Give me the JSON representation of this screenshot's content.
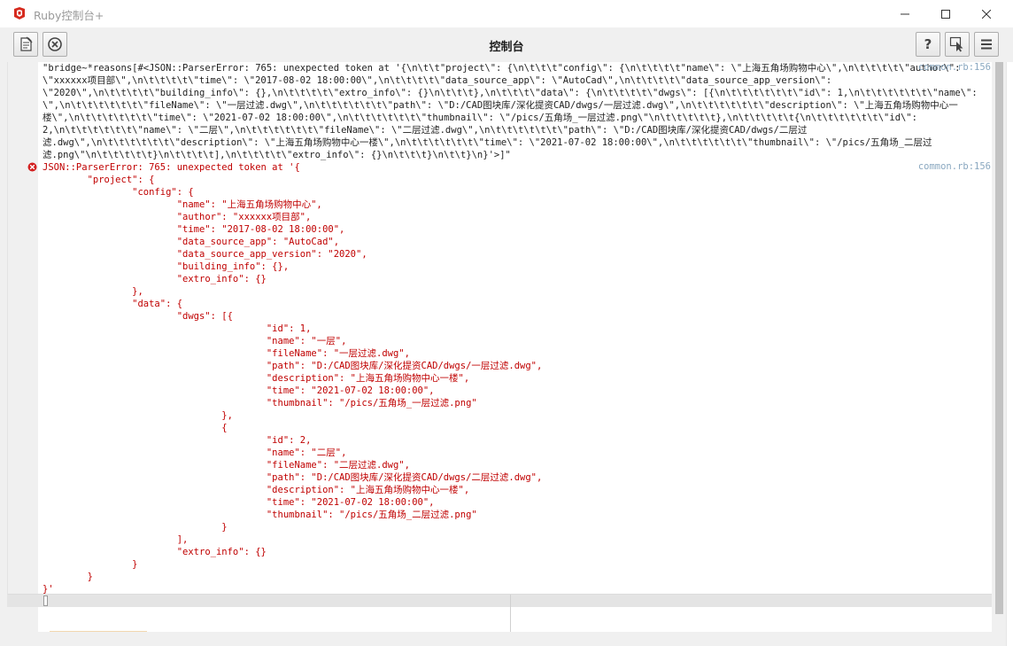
{
  "window": {
    "app_title": "Ruby控制台+",
    "app_icon": "sketchup-icon",
    "minimize_icon": "minimize-icon",
    "maximize_icon": "maximize-icon",
    "close_icon": "close-icon"
  },
  "toolbar": {
    "title": "控制台",
    "left_buttons": [
      "open-file-icon",
      "clear-icon"
    ],
    "right_buttons": [
      "help-icon",
      "inspect-cursor-icon",
      "menu-icon"
    ]
  },
  "console": {
    "bridge_message": "\"bridge~*reasons[#<JSON::ParserError: 765: unexpected token at '{\\n\\t\\t\"project\\\": {\\n\\t\\t\\t\"config\\\": {\\n\\t\\t\\t\\t\"name\\\": \\\"上海五角场购物中心\\\",\\n\\t\\t\\t\\t\\\"author\\\":\n\\\"xxxxxx项目部\\\",\\n\\t\\t\\t\\t\\\"time\\\": \\\"2017-08-02 18:00:00\\\",\\n\\t\\t\\t\\t\\\"data_source_app\\\": \\\"AutoCad\\\",\\n\\t\\t\\t\\t\\\"data_source_app_version\\\":\n\\\"2020\\\",\\n\\t\\t\\t\\t\\\"building_info\\\": {},\\n\\t\\t\\t\\t\\\"extro_info\\\": {}\\n\\t\\t\\t},\\n\\t\\t\\t\\\"data\\\": {\\n\\t\\t\\t\\t\\\"dwgs\\\": [{\\n\\t\\t\\t\\t\\t\\t\\\"id\\\": 1,\\n\\t\\t\\t\\t\\t\\t\\\"name\\\": \\\"一层\n\\\",\\n\\t\\t\\t\\t\\t\\t\\\"fileName\\\": \\\"一层过滤.dwg\\\",\\n\\t\\t\\t\\t\\t\\t\\\"path\\\": \\\"D:/CAD图块库/深化提资CAD/dwgs/一层过滤.dwg\\\",\\n\\t\\t\\t\\t\\t\\t\\\"description\\\": \\\"上海五角场购物中心一\n楼\\\",\\n\\t\\t\\t\\t\\t\\t\\\"time\\\": \\\"2021-07-02 18:00:00\\\",\\n\\t\\t\\t\\t\\t\\t\\\"thumbnail\\\": \\\"/pics/五角场_一层过滤.png\\\"\\n\\t\\t\\t\\t\\t},\\n\\t\\t\\t\\t\\t{\\n\\t\\t\\t\\t\\t\\t\\\"id\\\":\n2,\\n\\t\\t\\t\\t\\t\\t\\\"name\\\": \\\"二层\\\",\\n\\t\\t\\t\\t\\t\\t\\\"fileName\\\": \\\"二层过滤.dwg\\\",\\n\\t\\t\\t\\t\\t\\t\\\"path\\\": \\\"D:/CAD图块库/深化提资CAD/dwgs/二层过\n滤.dwg\\\",\\n\\t\\t\\t\\t\\t\\t\\\"description\\\": \\\"上海五角场购物中心一楼\\\",\\n\\t\\t\\t\\t\\t\\t\\\"time\\\": \\\"2021-07-02 18:00:00\\\",\\n\\t\\t\\t\\t\\t\\t\\\"thumbnail\\\": \\\"/pics/五角场_二层过\n滤.png\\\"\\n\\t\\t\\t\\t\\t}\\n\\t\\t\\t\\t],\\n\\t\\t\\t\\t\\\"extro_info\\\": {}\\n\\t\\t\\t}\\n\\t\\t}\\n}'>]\"",
    "bridge_source": "common.rb:156",
    "error_message": "JSON::ParserError: 765: unexpected token at '{\n        \"project\": {\n                \"config\": {\n                        \"name\": \"上海五角场购物中心\",\n                        \"author\": \"xxxxxx项目部\",\n                        \"time\": \"2017-08-02 18:00:00\",\n                        \"data_source_app\": \"AutoCad\",\n                        \"data_source_app_version\": \"2020\",\n                        \"building_info\": {},\n                        \"extro_info\": {}\n                },\n                \"data\": {\n                        \"dwgs\": [{\n                                        \"id\": 1,\n                                        \"name\": \"一层\",\n                                        \"fileName\": \"一层过滤.dwg\",\n                                        \"path\": \"D:/CAD图块库/深化提资CAD/dwgs/一层过滤.dwg\",\n                                        \"description\": \"上海五角场购物中心一楼\",\n                                        \"time\": \"2021-07-02 18:00:00\",\n                                        \"thumbnail\": \"/pics/五角场_一层过滤.png\"\n                                },\n                                {\n                                        \"id\": 2,\n                                        \"name\": \"二层\",\n                                        \"fileName\": \"二层过滤.dwg\",\n                                        \"path\": \"D:/CAD图块库/深化提资CAD/dwgs/二层过滤.dwg\",\n                                        \"description\": \"上海五角场购物中心一楼\",\n                                        \"time\": \"2021-07-02 18:00:00\",\n                                        \"thumbnail\": \"/pics/五角场_二层过滤.png\"\n                                }\n                        ],\n                        \"extro_info\": {}\n                }\n        }\n}'",
    "error_source": "common.rb:156",
    "error_icon": "error-icon",
    "input_value": ""
  },
  "colors": {
    "error_text": "#c00000",
    "link_text": "#8aa8c0",
    "gutter": "#f0f0f0"
  }
}
